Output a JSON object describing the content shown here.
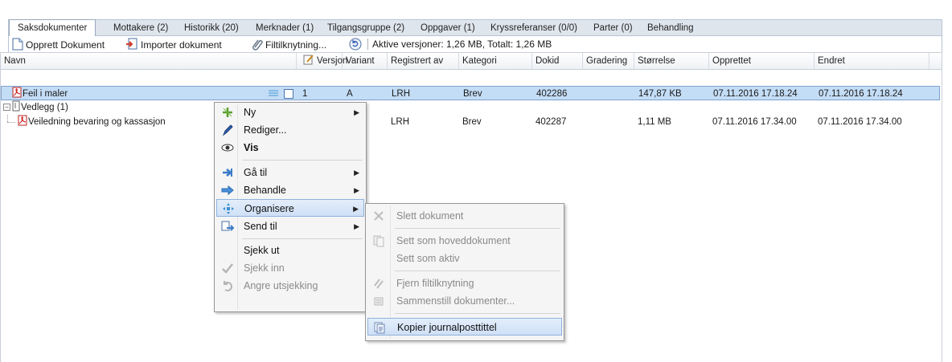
{
  "tabs": [
    {
      "label": "Saksdokumenter",
      "active": true
    },
    {
      "label": "Mottakere (2)"
    },
    {
      "label": "Historikk (20)"
    },
    {
      "label": "Merknader (1)"
    },
    {
      "label": "Tilgangsgruppe (2)"
    },
    {
      "label": "Oppgaver (1)"
    },
    {
      "label": "Kryssreferanser (0/0)"
    },
    {
      "label": "Parter (0)"
    },
    {
      "label": "Behandling"
    }
  ],
  "toolbar": {
    "create_label": "Opprett Dokument",
    "import_label": "Importer dokument",
    "link_label": "Filtilknytning...",
    "summary": "Aktive versjoner: 1,26 MB,  Totalt: 1,26 MB"
  },
  "columns": [
    "Navn",
    "Versjon",
    "Variant",
    "Registrert av",
    "Kategori",
    "Dokid",
    "Gradering",
    "Størrelse",
    "Opprettet",
    "Endret"
  ],
  "rows": [
    {
      "name": "Feil i maler",
      "version": "1",
      "variant": "A",
      "registered_by": "LRH",
      "category": "Brev",
      "dokid": "402286",
      "grading": "",
      "size": "147,87 KB",
      "created": "07.11.2016 17.18.24",
      "changed": "07.11.2016 17.18.24"
    },
    {
      "name": "Vedlegg (1)"
    },
    {
      "name": "Veiledning bevaring og kassasjon",
      "registered_by": "LRH",
      "category": "Brev",
      "dokid": "402287",
      "grading": "",
      "size": "1,11 MB",
      "created": "07.11.2016 17.34.00",
      "changed": "07.11.2016 17.34.00"
    }
  ],
  "context_menu": {
    "items": [
      {
        "label": "Ny",
        "icon": "new-icon",
        "submenu": true
      },
      {
        "label": "Rediger...",
        "icon": "pencil-icon"
      },
      {
        "label": "Vis",
        "icon": "eye-icon",
        "bold": true
      },
      {
        "label": "Gå til",
        "icon": "goto-icon",
        "submenu": true
      },
      {
        "label": "Behandle",
        "icon": "process-icon",
        "submenu": true
      },
      {
        "label": "Organisere",
        "icon": "organize-icon",
        "submenu": true,
        "highlighted": true
      },
      {
        "label": "Send til",
        "icon": "send-icon",
        "submenu": true
      },
      {
        "label": "Sjekk ut"
      },
      {
        "label": "Sjekk inn",
        "icon": "check-icon",
        "disabled": true
      },
      {
        "label": "Angre utsjekking",
        "icon": "undo-icon",
        "disabled": true
      }
    ]
  },
  "submenu": {
    "items": [
      {
        "label": "Slett dokument",
        "icon": "delete-icon",
        "disabled": true
      },
      {
        "label": "Sett som hoveddokument",
        "icon": "main-doc-icon",
        "disabled": true
      },
      {
        "label": "Sett som aktiv",
        "disabled": true
      },
      {
        "label": "Fjern filtilknytning",
        "icon": "unlink-icon",
        "disabled": true
      },
      {
        "label": "Sammenstill dokumenter...",
        "icon": "merge-icon",
        "disabled": true
      },
      {
        "label": "Kopier journalposttittel",
        "icon": "copy-icon",
        "highlighted": true
      }
    ]
  },
  "colors": {
    "selection": "#c4ddf6",
    "tabbar": "#dfe5ed",
    "menu_highlight": "#cfe0f6"
  }
}
